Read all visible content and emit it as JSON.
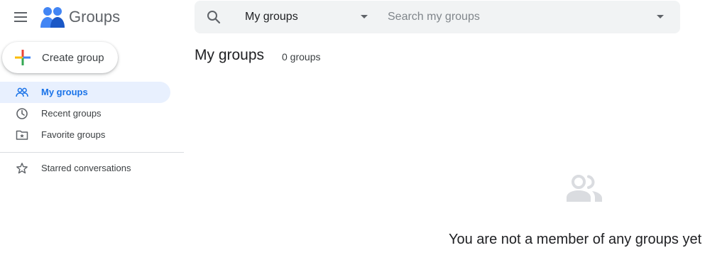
{
  "app": {
    "title": "Groups"
  },
  "icons": {
    "menu": "hamburger-menu-icon",
    "logo": "groups-logo-icon",
    "search": "search-icon",
    "create": "plus-icon",
    "empty_state": "people-icon"
  },
  "search": {
    "scope_value": "My groups",
    "placeholder": "Search my groups",
    "value": ""
  },
  "create_button": {
    "label": "Create group"
  },
  "sidebar": {
    "items": [
      {
        "label": "My groups",
        "icon": "people-icon",
        "active": true
      },
      {
        "label": "Recent groups",
        "icon": "clock-icon",
        "active": false
      },
      {
        "label": "Favorite groups",
        "icon": "star-folder-icon",
        "active": false
      },
      {
        "label": "Starred conversations",
        "icon": "star-outline-icon",
        "active": false
      }
    ]
  },
  "main": {
    "title": "My groups",
    "count": "0 groups",
    "empty_message": "You are not a member of any groups yet"
  },
  "colors": {
    "accent": "#1a73e8",
    "active_bg": "#e8f0fe",
    "searchbar_bg": "#f1f3f4",
    "logo_blue": "#4285f4",
    "plus_red": "#ea4335",
    "plus_yellow": "#fbbc04",
    "plus_green": "#34a853",
    "plus_blue": "#4285f4",
    "icon_gray": "#5f6368",
    "empty_icon_gray": "#dadce0"
  }
}
